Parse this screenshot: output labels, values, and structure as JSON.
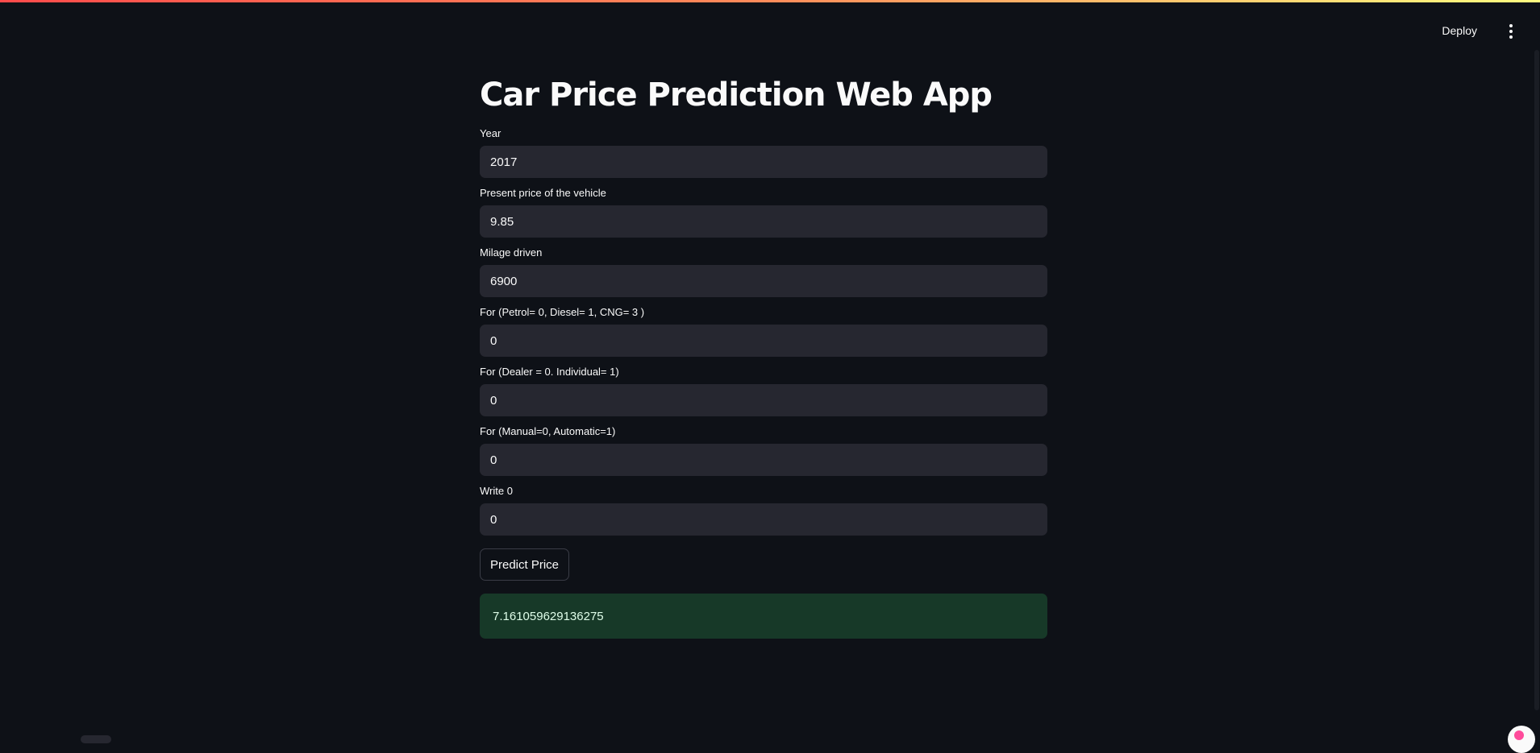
{
  "header": {
    "deploy_label": "Deploy",
    "menu_icon": "vertical-ellipsis-icon"
  },
  "main": {
    "title": "Car Price Prediction Web App",
    "fields": [
      {
        "label": "Year",
        "value": "2017"
      },
      {
        "label": "Present price of the vehicle",
        "value": "9.85"
      },
      {
        "label": "Milage driven",
        "value": "6900"
      },
      {
        "label": "For (Petrol= 0, Diesel= 1, CNG= 3 )",
        "value": "0"
      },
      {
        "label": "For (Dealer = 0. Individual= 1)",
        "value": "0"
      },
      {
        "label": "For (Manual=0, Automatic=1)",
        "value": "0"
      },
      {
        "label": "Write 0",
        "value": "0"
      }
    ],
    "predict_label": "Predict Price",
    "result": "7.161059629136275"
  },
  "colors": {
    "background": "#0e1117",
    "input_bg": "#262730",
    "success_bg": "#173928",
    "accent_gradient_start": "#ff4b4b",
    "accent_gradient_end": "#fffd80"
  }
}
